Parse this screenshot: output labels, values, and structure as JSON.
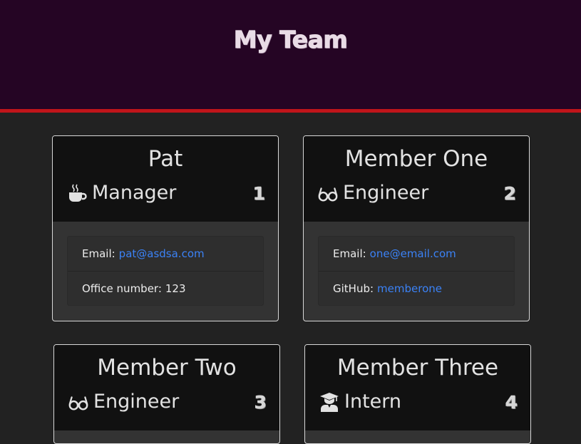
{
  "header": {
    "title": "My Team"
  },
  "colors": {
    "header_bg": "#250524",
    "accent_line": "#c0151a",
    "card_head_bg": "#111111",
    "card_body_bg": "#333333",
    "link": "#3b82f6"
  },
  "cards": [
    {
      "name": "Pat",
      "role": "Manager",
      "role_icon": "mug-icon",
      "id": "1",
      "rows": [
        {
          "label": "Email:",
          "value": "pat@asdsa.com"
        },
        {
          "label": "Office number:",
          "value": "123"
        }
      ]
    },
    {
      "name": "Member One",
      "role": "Engineer",
      "role_icon": "glasses-icon",
      "id": "2",
      "rows": [
        {
          "label": "Email:",
          "value": "one@email.com"
        },
        {
          "label": "GitHub:",
          "value": "memberone"
        }
      ]
    },
    {
      "name": "Member Two",
      "role": "Engineer",
      "role_icon": "glasses-icon",
      "id": "3"
    },
    {
      "name": "Member Three",
      "role": "Intern",
      "role_icon": "graduate-icon",
      "id": "4"
    }
  ]
}
